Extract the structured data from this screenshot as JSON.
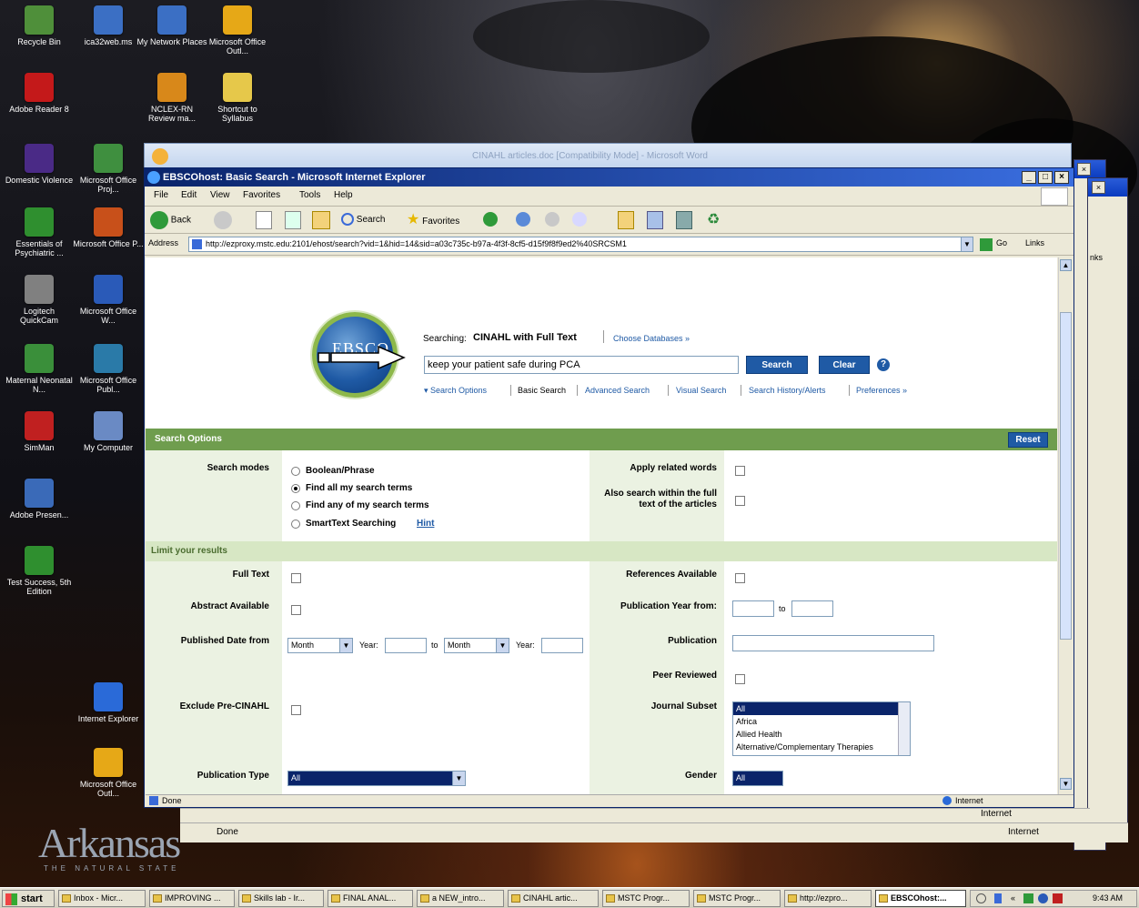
{
  "desktop": {
    "icons": [
      {
        "label": "Recycle Bin",
        "color": "#4f8f3a"
      },
      {
        "label": "ica32web.ms",
        "color": "#3b6fc4"
      },
      {
        "label": "My Network Places",
        "color": "#3b6fc4"
      },
      {
        "label": "Microsoft Office Outl...",
        "color": "#e6a817"
      },
      {
        "label": "Adobe Reader 8",
        "color": "#c4191a"
      },
      {
        "label": "NCLEX-RN Review ma...",
        "color": "#d8881a"
      },
      {
        "label": "Shortcut to Syllabus",
        "color": "#e6c84a"
      },
      {
        "label": "Domestic Violence",
        "color": "#4a2a86"
      },
      {
        "label": "Microsoft Office Proj...",
        "color": "#3f8f3f"
      },
      {
        "label": "Essentials of Psychiatric ...",
        "color": "#2f8f2f"
      },
      {
        "label": "Microsoft Office P...",
        "color": "#c8501a"
      },
      {
        "label": "Logitech QuickCam",
        "color": "#808080"
      },
      {
        "label": "Microsoft Office W...",
        "color": "#2a5ab8"
      },
      {
        "label": "Maternal Neonatal N...",
        "color": "#3a8f3a"
      },
      {
        "label": "Microsoft Office Publ...",
        "color": "#2a7aa8"
      },
      {
        "label": "SimMan",
        "color": "#c02020"
      },
      {
        "label": "My Computer",
        "color": "#6a8ac4"
      },
      {
        "label": "Adobe Presen...",
        "color": "#3a6ab8"
      },
      {
        "label": "Test Success, 5th Edition",
        "color": "#2f8f2f"
      },
      {
        "label": "Internet Explorer",
        "color": "#2a6ad8"
      },
      {
        "label": "Microsoft Office Outl...",
        "color": "#e6a817"
      }
    ],
    "wallpaper_title": "Arkansas",
    "wallpaper_subtitle": "THE NATURAL STATE"
  },
  "word_window": {
    "title": "CINAHL articles.doc [Compatibility Mode] - Microsoft Word"
  },
  "back_windows": {
    "links_label": "nks",
    "status_done": "Done",
    "zone_internet": "Internet"
  },
  "ie": {
    "title": "EBSCOhost: Basic Search - Microsoft Internet Explorer",
    "title_buttons": {
      "minimize": "_",
      "maximize": "□",
      "close": "×"
    },
    "menu": [
      "File",
      "Edit",
      "View",
      "Favorites",
      "Tools",
      "Help"
    ],
    "toolbar": {
      "back": "Back",
      "search": "Search",
      "favorites": "Favorites"
    },
    "address": {
      "label": "Address",
      "url": "http://ezproxy.mstc.edu:2101/ehost/search?vid=1&hid=14&sid=a03c735c-b97a-4f3f-8cf5-d15f9f8f9ed2%40SRCSM1",
      "go": "Go",
      "links": "Links"
    },
    "status": {
      "text": "Done",
      "zone": "Internet"
    }
  },
  "ebsco": {
    "logo_text": "EBSCO",
    "searching_label": "Searching:",
    "database": "CINAHL with Full Text",
    "choose_databases": "Choose Databases »",
    "query": "keep your patient safe during PCA",
    "search_btn": "Search",
    "clear_btn": "Clear",
    "help": "?",
    "links": [
      "▾ Search Options",
      "Basic Search",
      "Advanced Search",
      "Visual Search",
      "Search History/Alerts",
      "Preferences »"
    ],
    "search_options_header": "Search Options",
    "reset": "Reset",
    "search_modes_label": "Search modes",
    "modes": [
      {
        "label": "Boolean/Phrase",
        "selected": false
      },
      {
        "label": "Find all my search terms",
        "selected": true
      },
      {
        "label": "Find any of my search terms",
        "selected": false
      },
      {
        "label": "SmartText Searching",
        "selected": false
      }
    ],
    "hint": "Hint",
    "apply_related": "Apply related words",
    "also_search": "Also search within the full text of the articles",
    "limit_header": "Limit your results",
    "full_text": "Full Text",
    "references_available": "References Available",
    "abstract_available": "Abstract Available",
    "pub_year_from": "Publication Year from:",
    "to": "to",
    "published_date_from": "Published Date from",
    "month": "Month",
    "year": "Year:",
    "publication": "Publication",
    "peer_reviewed": "Peer Reviewed",
    "exclude_pre_cinahl": "Exclude Pre-CINAHL",
    "journal_subset": "Journal Subset",
    "journal_options": [
      "All",
      "Africa",
      "Allied Health",
      "Alternative/Complementary Therapies"
    ],
    "publication_type": "Publication Type",
    "publication_type_value": "All",
    "gender": "Gender",
    "gender_value": "All"
  },
  "taskbar": {
    "start": "start",
    "tasks": [
      "Inbox - Micr...",
      "IMPROVING ...",
      "Skills lab - Ir...",
      "FINAL ANAL...",
      "a NEW_intro...",
      "CINAHL artic...",
      "MSTC Progr...",
      "MSTC Progr...",
      "http://ezpro...",
      "EBSCOhost:..."
    ],
    "clock": "9:43 AM"
  },
  "colors": {
    "ebsco_blue": "#1f5aa5",
    "ebsco_green": "#6f9d4e",
    "xp_title": "#0a246a"
  }
}
